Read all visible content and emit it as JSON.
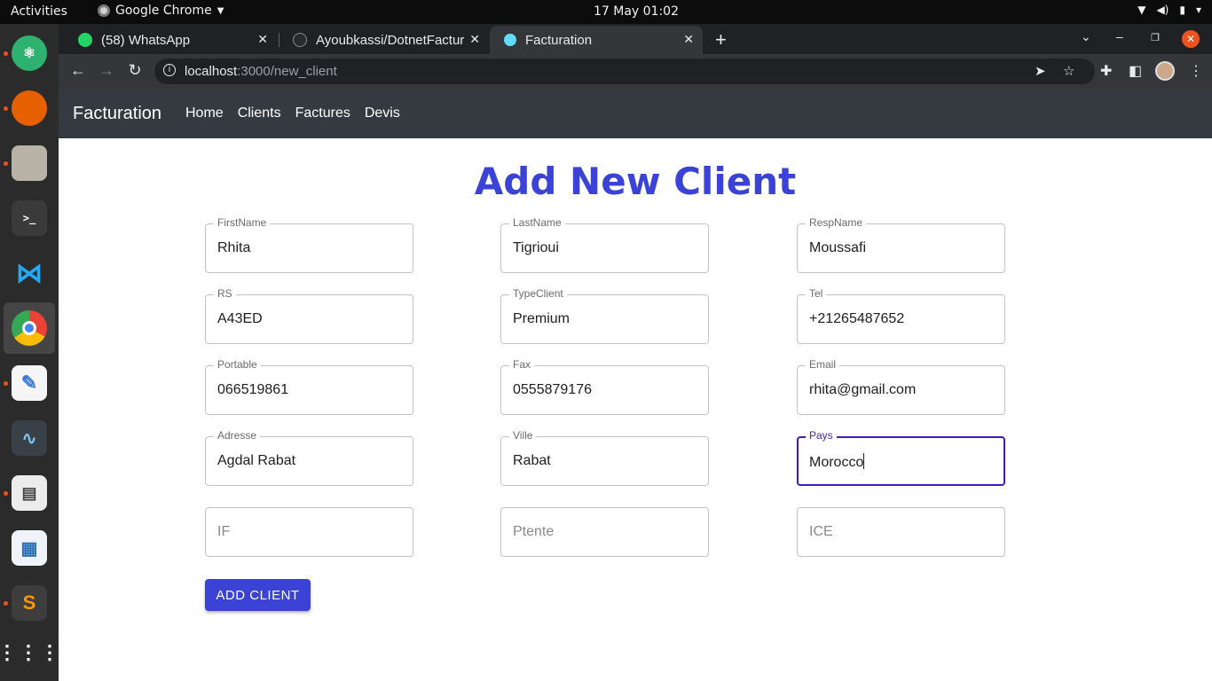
{
  "system": {
    "activities": "Activities",
    "app_name": "Google Chrome",
    "clock": "17 May  01:02"
  },
  "browser": {
    "tabs": [
      {
        "title": "(58) WhatsApp",
        "favicon_color": "#25d366"
      },
      {
        "title": "Ayoubkassi/DotnetFactur",
        "favicon_color": "#2a2a2a"
      },
      {
        "title": "Facturation",
        "favicon_color": "#61dafb"
      }
    ],
    "url_host": "localhost",
    "url_path": ":3000/new_client"
  },
  "navbar": {
    "brand": "Facturation",
    "links": [
      "Home",
      "Clients",
      "Factures",
      "Devis"
    ]
  },
  "form": {
    "title": "Add New Client",
    "fields": [
      {
        "label": "FirstName",
        "value": "Rhita"
      },
      {
        "label": "LastName",
        "value": "Tigrioui"
      },
      {
        "label": "RespName",
        "value": "Moussafi"
      },
      {
        "label": "RS",
        "value": "A43ED"
      },
      {
        "label": "TypeClient",
        "value": "Premium"
      },
      {
        "label": "Tel",
        "value": "+21265487652"
      },
      {
        "label": "Portable",
        "value": "066519861"
      },
      {
        "label": "Fax",
        "value": "0555879176"
      },
      {
        "label": "Email",
        "value": "rhita@gmail.com"
      },
      {
        "label": "Adresse",
        "value": "Agdal Rabat"
      },
      {
        "label": "Ville",
        "value": "Rabat"
      },
      {
        "label": "Pays",
        "value": "Morocco"
      }
    ],
    "placeholders": [
      "IF",
      "Ptente",
      "ICE"
    ],
    "submit_label": "ADD CLIENT"
  },
  "colors": {
    "accent": "#3b43d6",
    "focus": "#3f1bbd",
    "navbar_bg": "#343a40"
  }
}
